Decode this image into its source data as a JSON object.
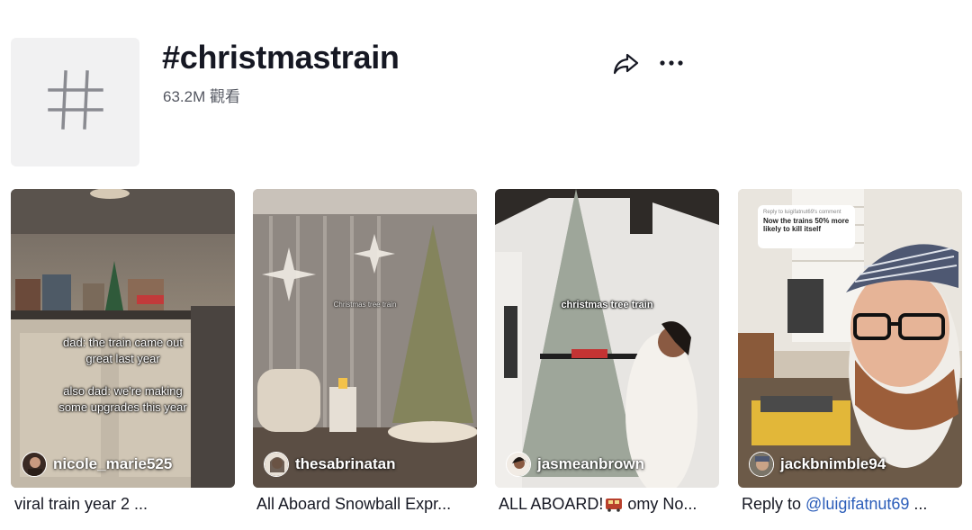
{
  "header": {
    "title": "#christmastrain",
    "views": "63.2M 觀看",
    "tag_icon": "hashtag-icon",
    "share_icon": "share-icon",
    "more_icon": "more-icon"
  },
  "videos": [
    {
      "author": "nicole_marie525",
      "caption": "viral train year 2 ...",
      "overlay": [
        "dad: the train came out",
        "great last year",
        "",
        "also dad: we're making",
        "some upgrades this year"
      ]
    },
    {
      "author": "thesabrinatan",
      "caption": "All Aboard Snowball Expr...",
      "overlay": [
        "Christmas tree train"
      ]
    },
    {
      "author": "jasmeanbrown",
      "caption_prefix": "ALL ABOARD!",
      "caption_suffix": " omy No...",
      "caption_emoji": "train-emoji",
      "overlay": [
        "christmas tree train"
      ]
    },
    {
      "author": "jackbnimble94",
      "caption_prefix": "Reply to ",
      "caption_mention": "@luigifatnut69",
      "caption_suffix": " ...",
      "comment": {
        "header": "Reply to luigifatnut69's comment",
        "text": "Now the trains 50% more likely to kill itself"
      }
    }
  ],
  "colors": {
    "accent_text": "#161823",
    "secondary_text": "#555862",
    "mention": "#2b5db9",
    "tag_tile": "#f1f1f2"
  }
}
